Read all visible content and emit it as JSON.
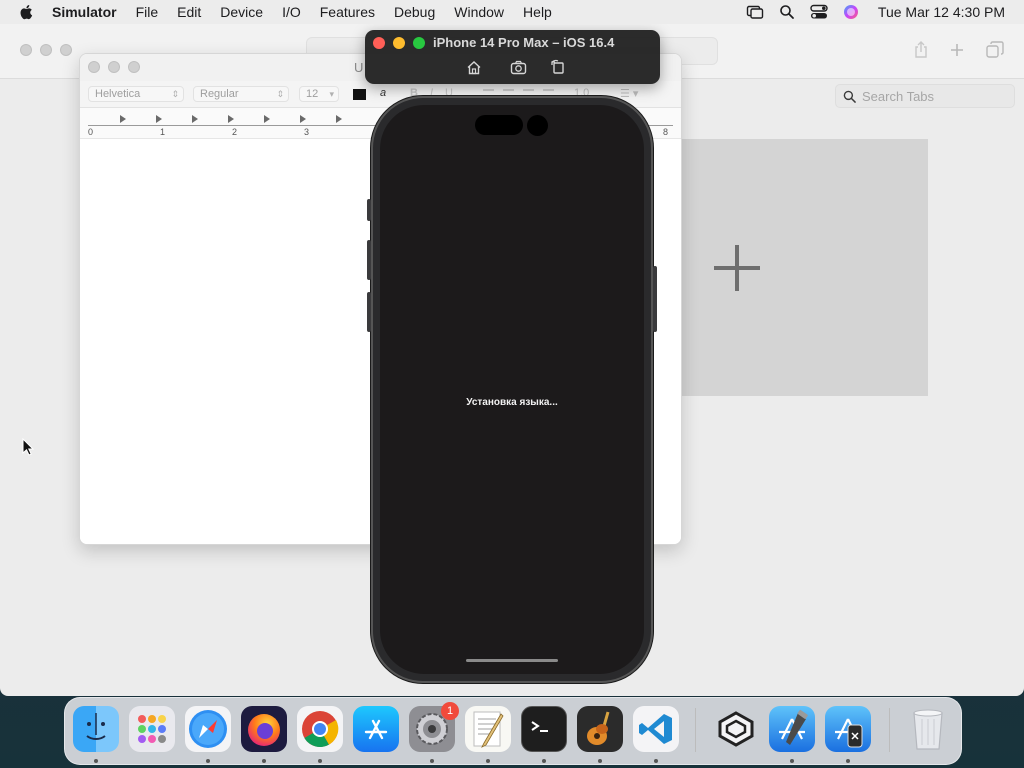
{
  "menubar": {
    "app_name": "Simulator",
    "items": [
      "File",
      "Edit",
      "Device",
      "I/O",
      "Features",
      "Debug",
      "Window",
      "Help"
    ],
    "clock": "Tue Mar 12  4:30 PM"
  },
  "browser": {
    "search_tabs_placeholder": "Search Tabs"
  },
  "textedit": {
    "title": "U",
    "font_family": "Helvetica",
    "font_style": "Regular",
    "font_size": "12",
    "highlight_glyph": "a",
    "style_buttons": [
      "B",
      "I",
      "U"
    ],
    "line_spacing": "1.0",
    "ruler_numbers": [
      "0",
      "1",
      "2",
      "3",
      "8"
    ]
  },
  "simulator": {
    "title": "iPhone 14 Pro Max – iOS 16.4",
    "screen_text": "Установка языка..."
  },
  "dock": {
    "badge_count": "1"
  },
  "colors": {
    "menubar_bg": "#ececec",
    "phone_screen": "#1c1a1b",
    "traffic_close": "#ff5f57",
    "traffic_min": "#febc2e",
    "traffic_max": "#28c840",
    "badge": "#f14a3b"
  }
}
